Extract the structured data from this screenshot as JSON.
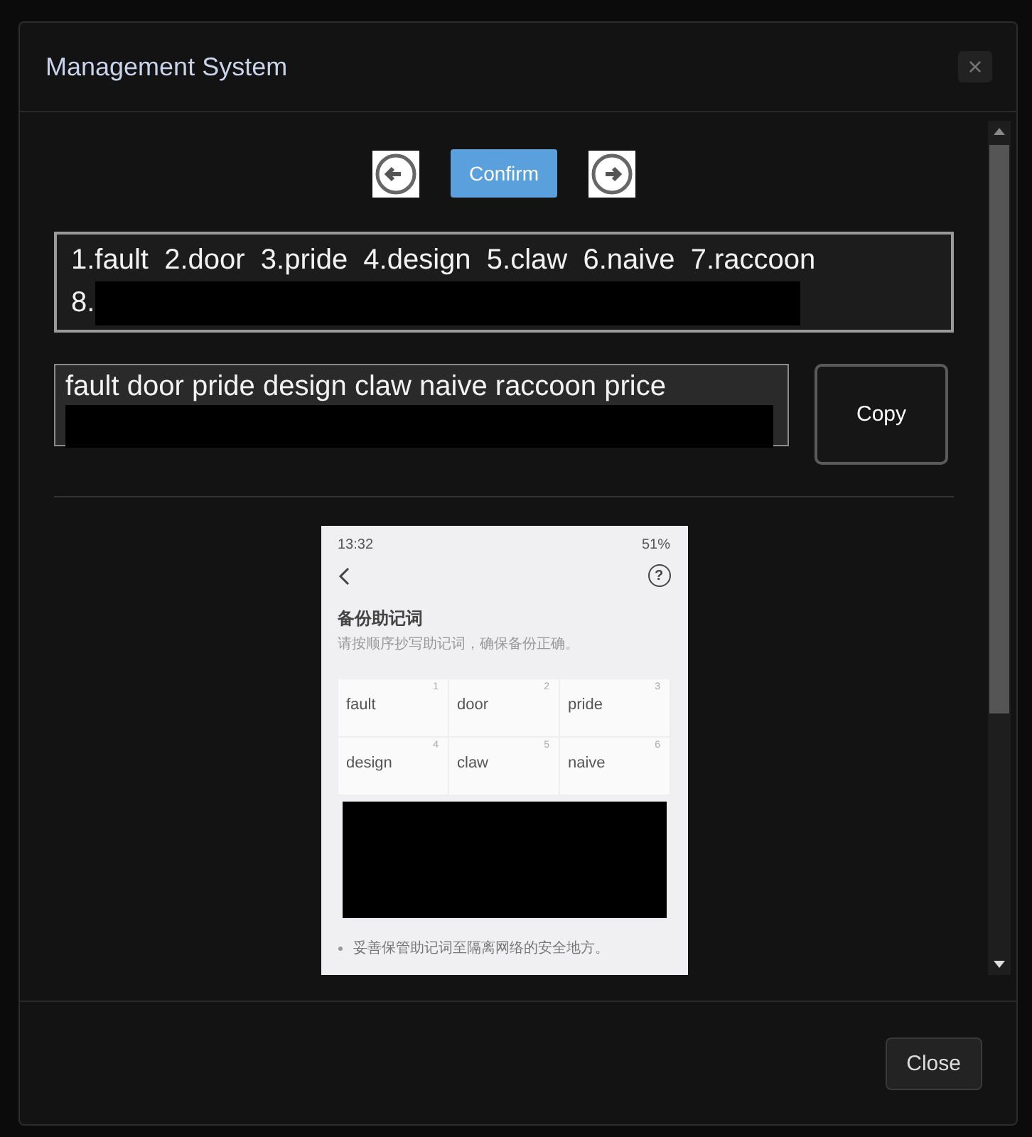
{
  "window": {
    "title": "Management System",
    "close_glyph": "×"
  },
  "nav": {
    "confirm": "Confirm"
  },
  "numbered_phrase": {
    "lines": [
      "1.fault  2.door  3.pride  4.design  5.claw  6.naive  7.raccoon",
      "8."
    ],
    "redacted": true
  },
  "plain_phrase": {
    "value": "fault door pride design claw naive raccoon price",
    "redacted": true
  },
  "copy_button": "Copy",
  "phone_screenshot": {
    "time": "13:32",
    "battery": "51%",
    "help_glyph": "?",
    "title": "备份助记词",
    "subtitle": "请按顺序抄写助记词，确保备份正确。",
    "words": [
      {
        "number": "1",
        "word": "fault"
      },
      {
        "number": "2",
        "word": "door"
      },
      {
        "number": "3",
        "word": "pride"
      },
      {
        "number": "4",
        "word": "design"
      },
      {
        "number": "5",
        "word": "claw"
      },
      {
        "number": "6",
        "word": "naive"
      }
    ],
    "redacted": true,
    "notes": [
      "妥善保管助记词至隔离网络的安全地方。"
    ]
  },
  "footer": {
    "close": "Close"
  }
}
